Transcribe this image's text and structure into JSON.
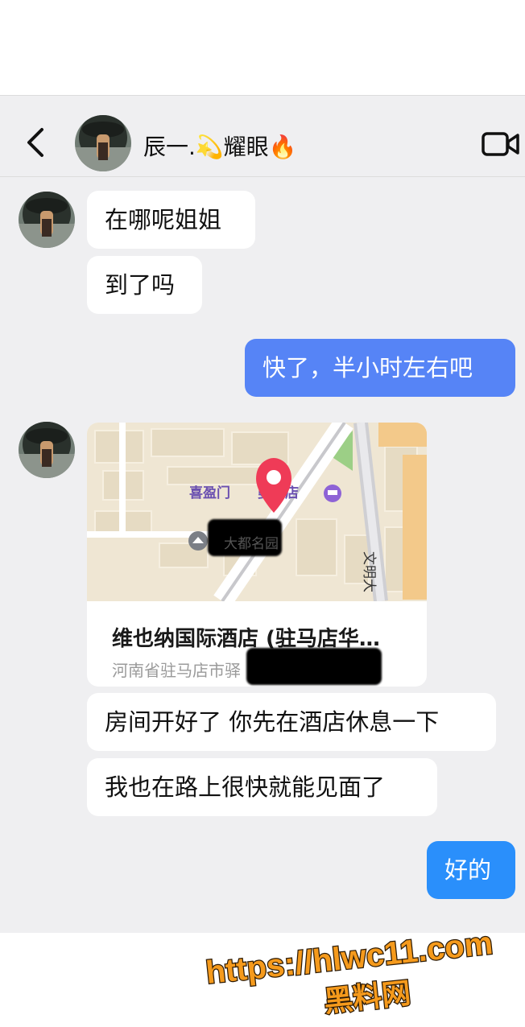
{
  "header": {
    "contact_name": "辰一.💫耀眼🔥",
    "back_icon": "chevron-left-icon",
    "video_icon": "video-camera-icon"
  },
  "messages": [
    {
      "from": "them",
      "text": "在哪呢姐姐"
    },
    {
      "from": "them",
      "text": "到了吗"
    },
    {
      "from": "me",
      "text": "快了，半小时左右吧"
    },
    {
      "from": "them",
      "type": "location"
    },
    {
      "from": "them",
      "text": "房间开好了 你先在酒店休息一下"
    },
    {
      "from": "them",
      "text": "我也在路上很快就能见面了"
    },
    {
      "from": "me",
      "text": "好的"
    }
  ],
  "location": {
    "title": "维也纳国际酒店 (驻马店华…",
    "address": "河南省驻马店市驿　　　金河街道…",
    "map_labels": {
      "hotel": "喜盈门　　曼酒店",
      "community": "大都名园",
      "road": "文明大"
    }
  },
  "watermark": {
    "url": "https://hlwc11.com",
    "name": "黑料网"
  },
  "colors": {
    "chat_bg": "#efeff1",
    "bubble_them": "#ffffff",
    "bubble_me_1": "#5684f6",
    "bubble_me_2": "#2a8ffb",
    "watermark_fill": "#f59a1c"
  }
}
